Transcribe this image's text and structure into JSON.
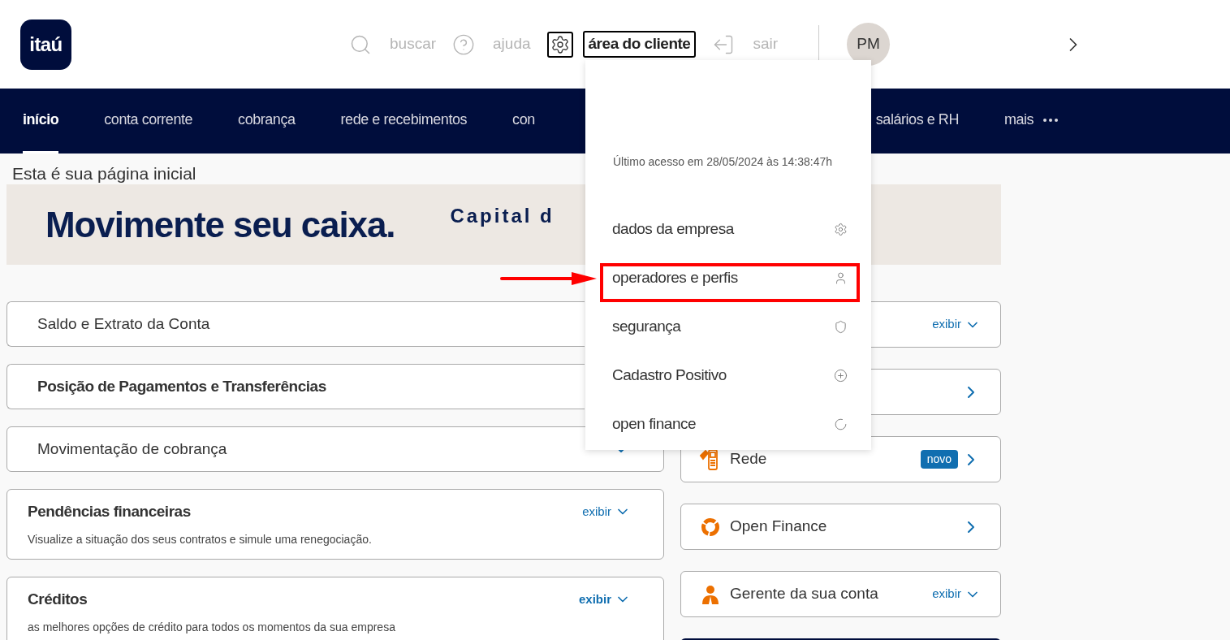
{
  "header": {
    "logo": "itaú",
    "actions": [
      {
        "kind": "search",
        "label": "buscar",
        "expanded": false
      },
      {
        "kind": "help",
        "label": "ajuda",
        "expanded": false
      },
      {
        "kind": "settings",
        "label": "área do cliente",
        "expanded": true
      },
      {
        "kind": "logout",
        "label": "sair",
        "expanded": false
      }
    ],
    "avatar": "PM"
  },
  "nav": [
    {
      "label": "início",
      "selected": true
    },
    {
      "label": "conta corrente",
      "selected": false
    },
    {
      "label": "cobrança",
      "selected": false
    },
    {
      "label": "rede e recebimentos",
      "selected": false
    },
    {
      "label": "con",
      "selected": false,
      "kind": "cut"
    },
    {
      "label": "salários e RH",
      "selected": false
    },
    {
      "label": "mais",
      "selected": false,
      "kind": "more"
    }
  ],
  "page_title": "Esta é sua página inicial",
  "banner": {
    "headline": "Movimente seu caixa.",
    "tagline": "Capital d"
  },
  "left_cards": [
    {
      "kind": "plain",
      "title": "Saldo e Extrato da Conta"
    },
    {
      "kind": "heading",
      "title": "Posição de Pagamentos e Transferências"
    },
    {
      "kind": "plain",
      "title": "Movimentação de cobrança",
      "action": {
        "kind": "chevron"
      }
    },
    {
      "kind": "heading",
      "title": "Pendências financeiras",
      "subtitle": "Visualize a situação dos seus contratos e simule uma renegociação.",
      "action": {
        "kind": "exibir",
        "label": "exibir",
        "bold": false
      }
    },
    {
      "kind": "heading",
      "title": "Créditos",
      "subtitle": "as melhores opções de crédito para todos os momentos da sua empresa",
      "action": {
        "kind": "exibir",
        "label": "exibir",
        "bold": true
      }
    }
  ],
  "right_cards": [
    {
      "kind": "plain",
      "action": {
        "kind": "exibir",
        "label": "exibir"
      }
    },
    {
      "kind": "plain",
      "action": {
        "kind": "arrow"
      }
    },
    {
      "kind": "machine",
      "title": "Rede",
      "badge": "novo",
      "action": {
        "kind": "arrow"
      }
    },
    {
      "kind": "donut",
      "title": "Open Finance",
      "action": {
        "kind": "arrow"
      }
    },
    {
      "kind": "person",
      "title": "Gerente da sua conta",
      "action": {
        "kind": "exibir",
        "label": "exibir"
      }
    },
    {
      "kind": "dark"
    }
  ],
  "menu": {
    "last_access": "Último acesso em 28/05/2024 às 14:38:47h",
    "items": [
      {
        "label": "dados da empresa",
        "annotated": false
      },
      {
        "label": "operadores e perfis",
        "annotated": true
      },
      {
        "label": "segurança",
        "annotated": false
      },
      {
        "label": "Cadastro Positivo",
        "annotated": false
      },
      {
        "label": "open finance",
        "annotated": false
      }
    ]
  }
}
